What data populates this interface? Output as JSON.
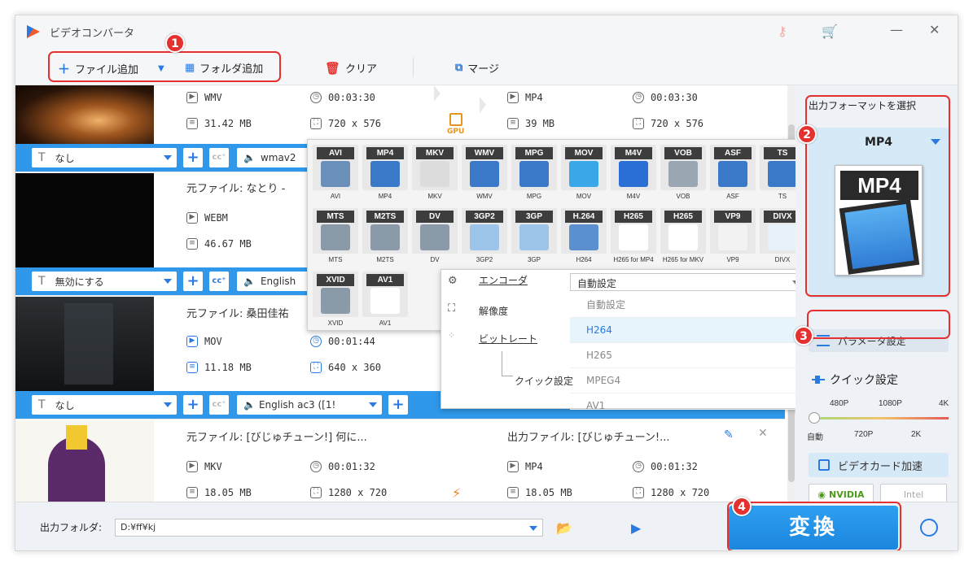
{
  "app": {
    "title": "ビデオコンバータ"
  },
  "toolbar": {
    "add_file": "ファイル追加",
    "add_folder": "フォルダ追加",
    "clear": "クリア",
    "merge": "マージ"
  },
  "badges": [
    "1",
    "2",
    "3",
    "4"
  ],
  "files": [
    {
      "src_name": "",
      "src_format": "WMV",
      "src_duration": "00:03:30",
      "src_size": "31.42 MB",
      "src_res": "720 x 576",
      "out_format": "MP4",
      "out_duration": "00:03:30",
      "out_size": "39 MB",
      "out_res": "720 x 576",
      "subtitle": "なし",
      "audio": "wmav2"
    },
    {
      "src_name": "元ファイル: なとり -",
      "src_format": "WEBM",
      "src_size": "46.67 MB",
      "subtitle": "無効にする",
      "audio": "English"
    },
    {
      "src_name": "元ファイル: 桑田佳祐",
      "src_format": "MOV",
      "src_duration": "00:01:44",
      "src_size": "11.18 MB",
      "src_res": "640 x 360",
      "subtitle": "なし",
      "audio": "English ac3 ([1!"
    },
    {
      "src_name": "元ファイル: [びじゅチューン!] 何に...",
      "out_name": "出力ファイル: [びじゅチューン!...",
      "src_format": "MKV",
      "src_duration": "00:01:32",
      "src_size": "18.05 MB",
      "src_res": "1280 x 720",
      "out_format": "MP4",
      "out_duration": "00:01:32",
      "out_size": "18.05 MB",
      "out_res": "1280 x 720"
    }
  ],
  "gpu_label": "GPU",
  "formats": [
    {
      "tag": "AVI",
      "label": "AVI",
      "color": "#6a8fb8"
    },
    {
      "tag": "MP4",
      "label": "MP4",
      "color": "#3a78c8"
    },
    {
      "tag": "MKV",
      "label": "MKV",
      "color": "#dcdcdc"
    },
    {
      "tag": "WMV",
      "label": "WMV",
      "color": "#3a78c8"
    },
    {
      "tag": "MPG",
      "label": "MPG",
      "color": "#3a78c8"
    },
    {
      "tag": "MOV",
      "label": "MOV",
      "color": "#39a7e8"
    },
    {
      "tag": "M4V",
      "label": "M4V",
      "color": "#2b6fd6"
    },
    {
      "tag": "VOB",
      "label": "VOB",
      "color": "#9aa6b2"
    },
    {
      "tag": "ASF",
      "label": "ASF",
      "color": "#3a78c8"
    },
    {
      "tag": "TS",
      "label": "TS",
      "color": "#3a78c8"
    },
    {
      "tag": "MTS",
      "label": "MTS",
      "color": "#8a9aa8"
    },
    {
      "tag": "M2TS",
      "label": "M2TS",
      "color": "#8a9aa8"
    },
    {
      "tag": "DV",
      "label": "DV",
      "color": "#8a9aa8"
    },
    {
      "tag": "3GP2",
      "label": "3GP2",
      "color": "#9cc4e8"
    },
    {
      "tag": "3GP",
      "label": "3GP",
      "color": "#9cc4e8"
    },
    {
      "tag": "H.264",
      "label": "H264",
      "color": "#5b8fd0"
    },
    {
      "tag": "H265",
      "label": "H265 for MP4",
      "color": "#ffffff"
    },
    {
      "tag": "H265",
      "label": "H265 for MKV",
      "color": "#ffffff"
    },
    {
      "tag": "VP9",
      "label": "VP9",
      "color": "#f2f2f2"
    },
    {
      "tag": "DIVX",
      "label": "DIVX",
      "color": "#e8f0f8"
    },
    {
      "tag": "XVID",
      "label": "XVID",
      "color": "#8a9aa8"
    },
    {
      "tag": "AV1",
      "label": "AV1",
      "color": "#ffffff"
    }
  ],
  "encoder_panel": {
    "encoder_label": "エンコーダ",
    "resolution_label": "解像度",
    "bitrate_label": "ビットレート",
    "quick_label": "クイック設定",
    "selected": "自動設定",
    "options": [
      "自動設定",
      "H264",
      "H265",
      "MPEG4",
      "AV1"
    ],
    "active_option": "H264"
  },
  "right_panel": {
    "output_title": "出力フォーマットを選択",
    "format": "MP4",
    "format_logo": "MP4",
    "param_button": "パラメータ設定",
    "quick": "クイック設定",
    "res_top": [
      "480P",
      "1080P",
      "4K"
    ],
    "res_bottom": [
      "自動",
      "720P",
      "2K"
    ],
    "gpu_accel": "ビデオカード加速",
    "nvidia": "NVIDIA",
    "intel": "Intel"
  },
  "bottom": {
    "output_folder_label": "出力フォルダ:",
    "output_path": "D:¥ff¥kj",
    "convert": "変換"
  },
  "colors": {
    "accent": "#2a7ae2",
    "highlight": "#e53030",
    "optbar": "#2f98ea"
  }
}
